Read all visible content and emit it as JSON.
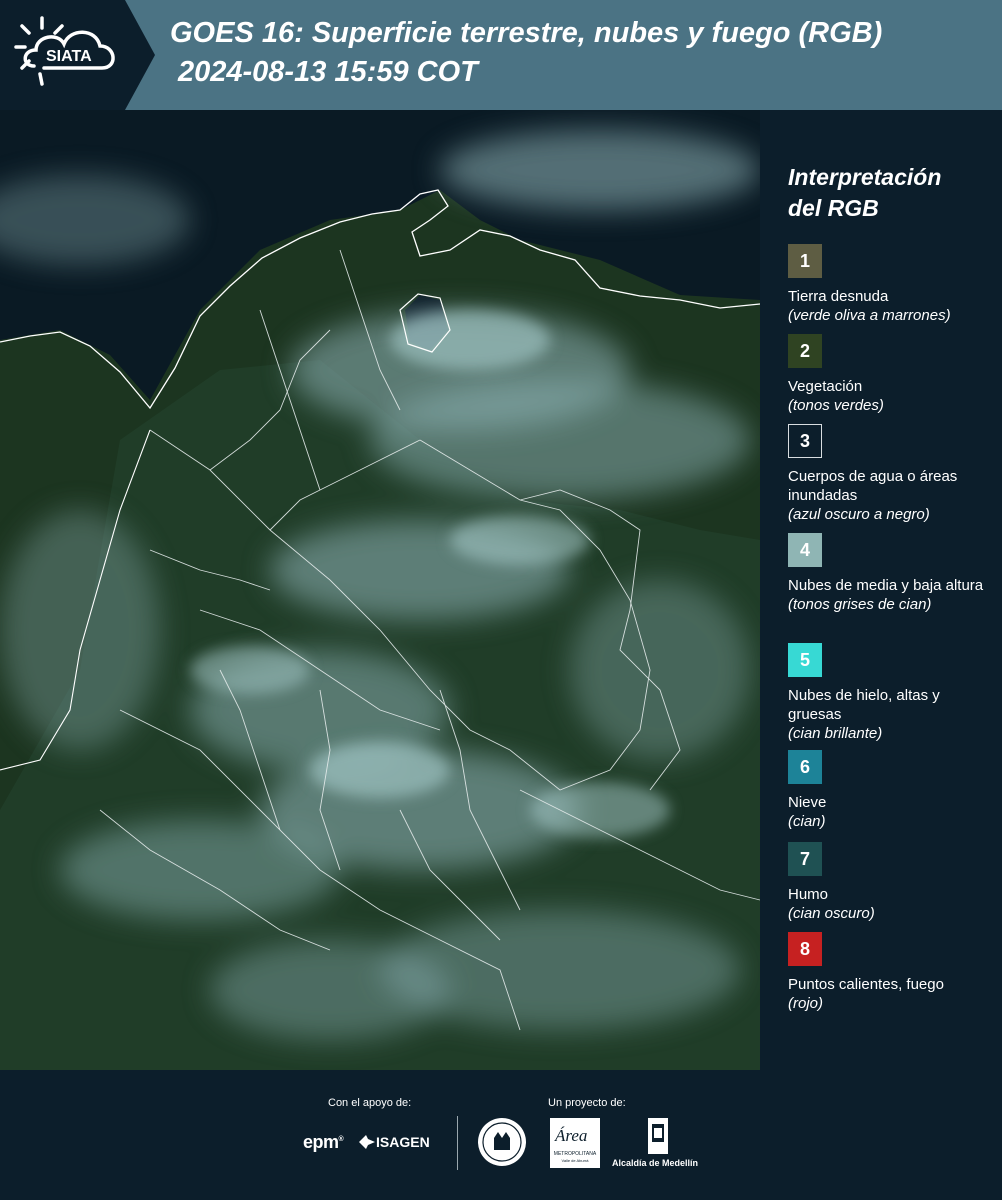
{
  "header": {
    "logo_text": "SIATA",
    "title_line1": "GOES 16: Superficie terrestre, nubes y fuego (RGB)",
    "title_line2": "2024-08-13 15:59 COT"
  },
  "legend": {
    "title_line1": "Interpretación",
    "title_line2": "del RGB",
    "items": [
      {
        "number": "1",
        "color": "#5e5d43",
        "label": "Tierra desnuda",
        "desc": "(verde oliva a marrones)"
      },
      {
        "number": "2",
        "color": "#2f4322",
        "label": "Vegetación",
        "desc": "(tonos verdes)"
      },
      {
        "number": "3",
        "color": "#0c1e2b",
        "label": "Cuerpos de agua o áreas inundadas",
        "desc": "(azul oscuro a negro)"
      },
      {
        "number": "4",
        "color": "#8fb5b4",
        "label": "Nubes de media y baja altura",
        "desc": "(tonos grises de cian)"
      },
      {
        "number": "5",
        "color": "#37d9d4",
        "label": "Nubes de hielo, altas y gruesas",
        "desc": "(cian brillante)"
      },
      {
        "number": "6",
        "color": "#1d8398",
        "label": "Nieve",
        "desc": "(cian)"
      },
      {
        "number": "7",
        "color": "#1f5153",
        "label": "Humo",
        "desc": "(cian oscuro)"
      },
      {
        "number": "8",
        "color": "#c62121",
        "label": "Puntos calientes, fuego",
        "desc": "(rojo)"
      }
    ]
  },
  "footer": {
    "support_caption": "Con el apoyo de:",
    "project_caption": "Un proyecto de:",
    "sponsor_epm": "epm",
    "sponsor_isagen": "ISAGEN",
    "partner_area": "Área",
    "partner_area_sub": "METROPOLITANA",
    "partner_area_sub2": "Valle de Aburrá",
    "partner_alcaldia": "Alcaldía de Medellín"
  }
}
